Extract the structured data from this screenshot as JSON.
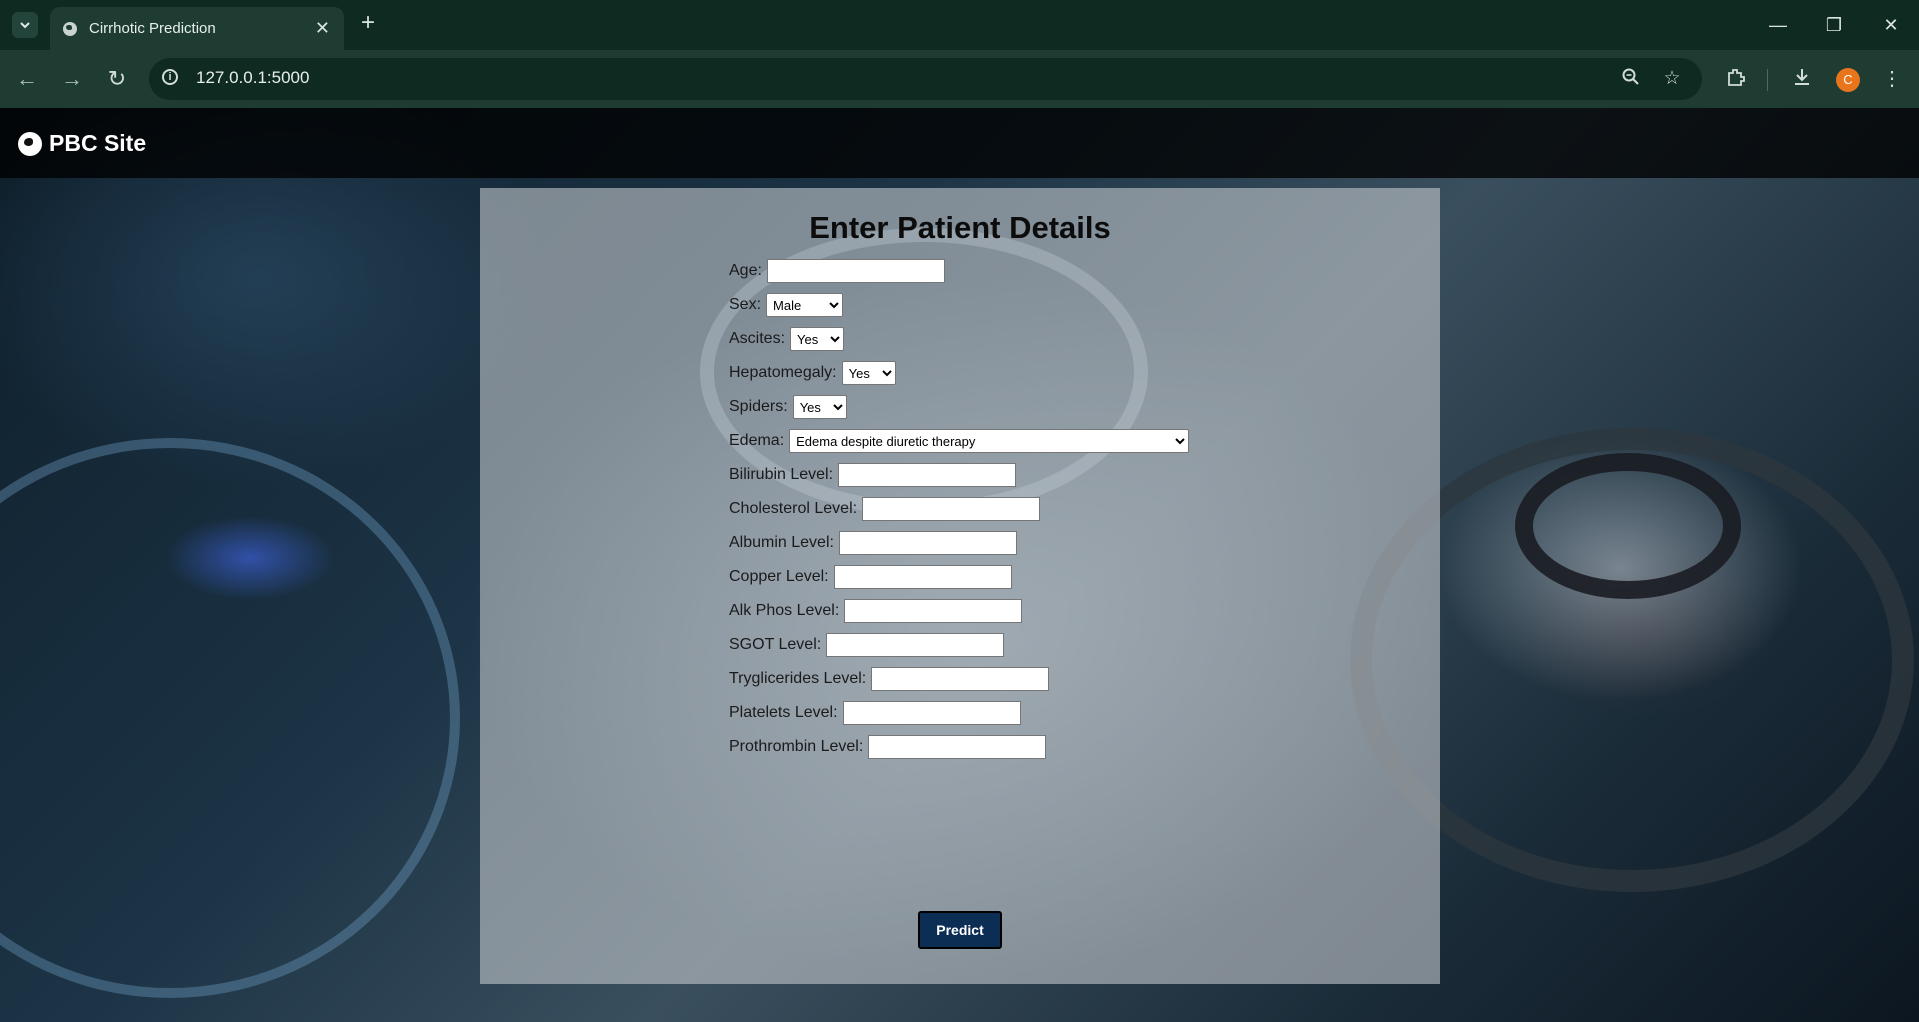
{
  "browser": {
    "tab_title": "Cirrhotic Prediction",
    "url": "127.0.0.1:5000",
    "profile_initial": "C"
  },
  "site": {
    "brand": "PBC Site"
  },
  "form": {
    "heading": "Enter Patient Details",
    "age_label": "Age:",
    "sex_label": "Sex:",
    "sex_value": "Male",
    "ascites_label": "Ascites:",
    "ascites_value": "Yes",
    "hepatomegaly_label": "Hepatomegaly:",
    "hepatomegaly_value": "Yes",
    "spiders_label": "Spiders:",
    "spiders_value": "Yes",
    "edema_label": "Edema:",
    "edema_value": "Edema despite diuretic therapy",
    "bilirubin_label": "Bilirubin Level:",
    "cholesterol_label": "Cholesterol Level:",
    "albumin_label": "Albumin Level:",
    "copper_label": "Copper Level:",
    "alk_phos_label": "Alk Phos Level:",
    "sgot_label": "SGOT Level:",
    "tryglicerides_label": "Tryglicerides Level:",
    "platelets_label": "Platelets Level:",
    "prothrombin_label": "Prothrombin Level:",
    "submit_label": "Predict"
  },
  "colors": {
    "browser_frame": "#0f2a21",
    "toolbar": "#1e3c31",
    "button": "#0c2e55",
    "avatar": "#e8741b"
  },
  "icons": [
    "tab-search-icon",
    "globe-icon",
    "close-icon",
    "plus-icon",
    "minimize-icon",
    "restore-icon",
    "back-icon",
    "forward-icon",
    "reload-icon",
    "site-info-icon",
    "zoom-icon",
    "bookmark-star-icon",
    "extensions-icon",
    "download-icon",
    "menu-dots-icon"
  ]
}
